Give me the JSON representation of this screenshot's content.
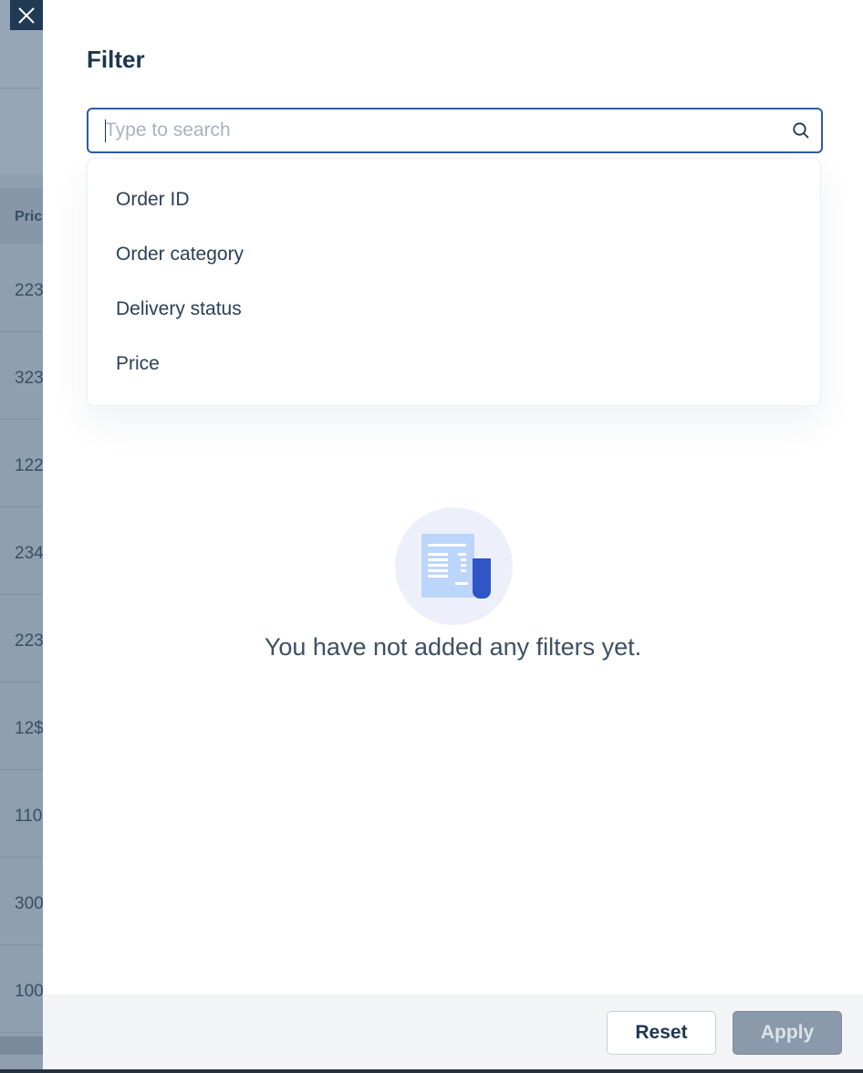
{
  "background_table": {
    "column_header": "Pric",
    "row_values": [
      "223",
      "323",
      "122",
      "234",
      "223",
      "12$",
      "110",
      "300",
      "100"
    ]
  },
  "drawer": {
    "title": "Filter",
    "search": {
      "placeholder": "Type to search",
      "value": ""
    },
    "dropdown_items": [
      "Order ID",
      "Order category",
      "Delivery status",
      "Price"
    ],
    "empty_state": {
      "message": "You have not added any filters yet.",
      "icon": "document-icon"
    },
    "footer": {
      "reset_label": "Reset",
      "apply_label": "Apply"
    }
  },
  "colors": {
    "accent": "#2e5aa8",
    "title": "#1d3550",
    "overlay": "#8f9fb0",
    "apply_disabled": "#8a9aaa"
  }
}
